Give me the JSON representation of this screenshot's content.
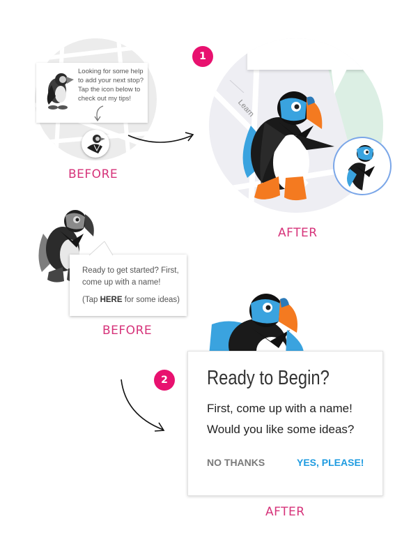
{
  "top_before": {
    "tip_lines": [
      "Looking for some help",
      "to add your next stop?",
      "Tap the icon below to",
      "check out my tips!"
    ],
    "caption": "BEFORE"
  },
  "top_after": {
    "badge": "1",
    "map_street": "Learn",
    "caption": "AFTER"
  },
  "bottom_before": {
    "tip_line1": "Ready to get started? First,",
    "tip_line2": "come up with a name!",
    "tip_prefix": "(Tap ",
    "tip_bold": "HERE",
    "tip_suffix": " for some ideas)",
    "caption": "BEFORE"
  },
  "bottom_after": {
    "badge": "2",
    "dialog": {
      "title": "Ready to Begin?",
      "line1": "First, come up with a name!",
      "line2": "Would you like some ideas?",
      "negative": "NO THANKS",
      "positive": "YES, PLEASE!"
    },
    "caption": "AFTER"
  },
  "colors": {
    "caption": "#d6337a",
    "badge": "#e8116f",
    "puffin_blue": "#3aa3df",
    "beak_orange": "#f47a20",
    "positive_button": "#1e9be0"
  }
}
